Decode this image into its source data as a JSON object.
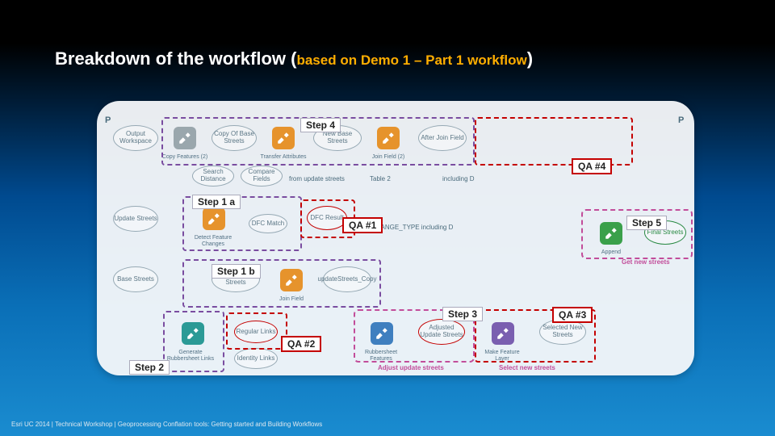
{
  "title_main": "Breakdown of the workflow ",
  "title_sub_open": "(",
  "title_sub": "based on Demo 1 – Part 1 workflow",
  "title_sub_close": ")",
  "footer": "Esri UC 2014 | Technical Workshop |  Geoprocessing Conflation tools: Getting started and Building Workflows",
  "labels": {
    "step4": "Step 4",
    "step1a": "Step 1 a",
    "step1b": "Step 1 b",
    "step2": "Step 2",
    "step3": "Step 3",
    "step5": "Step 5",
    "qa1": "QA #1",
    "qa2": "QA #2",
    "qa3": "QA #3",
    "qa4": "QA #4"
  },
  "panel": {
    "p_left": "P",
    "p_right": "P",
    "from_update": "from update streets",
    "change_type": "CHANGE_TYPE including D",
    "adjust_sel": "Adjust update streets",
    "select_new": "Select new streets"
  },
  "nodes": {
    "out_ws": "Output Workspace",
    "copy_feat": "Copy Features (2)",
    "copy_base": "Copy Of Base Streets",
    "transfer": "Transfer Attributes",
    "new_base": "New Base Streets",
    "join_field": "Join Field (2)",
    "after_join": "After Join Field",
    "search": "Search Distance",
    "compare": "Compare Fields",
    "table2": "Table 2",
    "includingD": "including D",
    "update_str": "Update Streets",
    "dfc": "Detect Feature Changes",
    "dfc_match": "DFC Match",
    "dfc_res": "DFC Result",
    "base_str": "Base Streets",
    "copy_upd": "Copy Of Update Streets",
    "join_f2": "Join Field",
    "upd_copy": "updateStreets_Copy",
    "append": "Append",
    "final": "Final Streets",
    "getnew": "Get new streets",
    "gen_rs": "Generate Rubbersheet Links",
    "reg_links": "Regular Links",
    "ident_links": "Identity Links",
    "rs_feat": "Rubbersheet Features",
    "adj_upd": "Adjusted Update Streets",
    "make_fl": "Make Feature Layer",
    "sel_new": "Selected New Streets"
  }
}
